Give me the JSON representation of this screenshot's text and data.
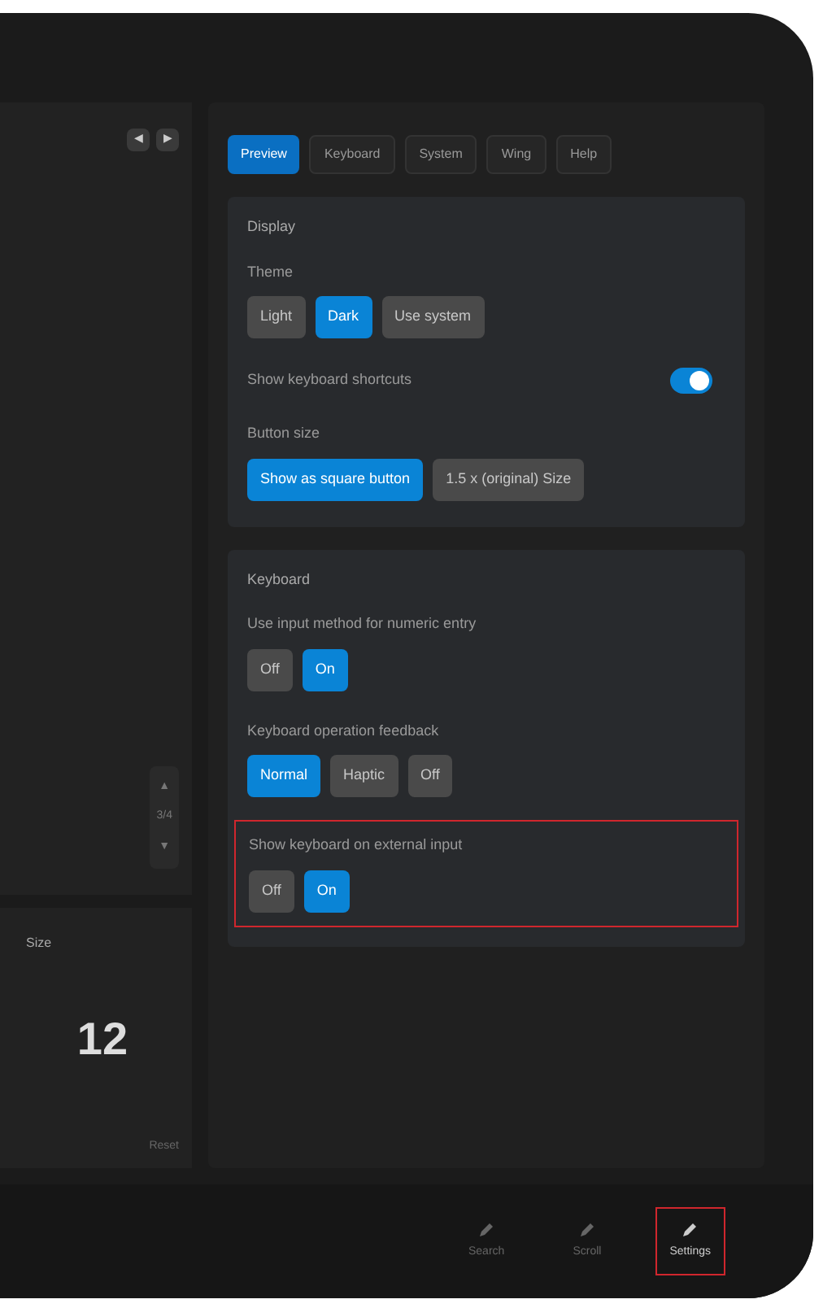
{
  "tabs": [
    {
      "label": "Preview",
      "selected": true
    },
    {
      "label": "Keyboard",
      "selected": false
    },
    {
      "label": "System",
      "selected": false
    },
    {
      "label": "Wing",
      "selected": false
    },
    {
      "label": "Help",
      "selected": false
    }
  ],
  "preview_controls": [
    "◀",
    "▶"
  ],
  "side_steps": [
    "▲",
    "3/4",
    "▼"
  ],
  "size_panel": {
    "label": "Size",
    "value": "12",
    "footer": "Reset"
  },
  "sections": [
    {
      "title": "Display",
      "rows": [
        {
          "kind": "choice",
          "label": "Theme",
          "highlighted": false,
          "options": [
            {
              "label": "Light",
              "selected": false
            },
            {
              "label": "Dark",
              "selected": true
            },
            {
              "label": "Use system",
              "selected": false
            }
          ]
        },
        {
          "kind": "toggle",
          "label": "Show keyboard shortcuts",
          "on": true,
          "highlighted": false
        },
        {
          "kind": "choice",
          "label": "Button size",
          "highlighted": false,
          "options": [
            {
              "label": "Show as square button",
              "selected": true
            },
            {
              "label": "1.5 x (original) Size",
              "selected": false
            }
          ]
        }
      ]
    },
    {
      "title": "Keyboard",
      "rows": [
        {
          "kind": "choice",
          "label": "Use input method for numeric entry",
          "highlighted": false,
          "options": [
            {
              "label": "Off",
              "selected": false
            },
            {
              "label": "On",
              "selected": true
            }
          ]
        },
        {
          "kind": "choice",
          "label": "Keyboard operation feedback",
          "highlighted": false,
          "options": [
            {
              "label": "Normal",
              "selected": true
            },
            {
              "label": "Haptic",
              "selected": false
            },
            {
              "label": "Off",
              "selected": false
            }
          ]
        },
        {
          "kind": "choice",
          "label": "Show keyboard on external input",
          "highlighted": true,
          "options": [
            {
              "label": "Off",
              "selected": false
            },
            {
              "label": "On",
              "selected": true
            }
          ]
        }
      ]
    }
  ],
  "bottom_bar": [
    {
      "label": "Search",
      "selected": false,
      "highlighted": false
    },
    {
      "label": "Scroll",
      "selected": false,
      "highlighted": false
    },
    {
      "label": "Settings",
      "selected": true,
      "highlighted": true
    }
  ]
}
